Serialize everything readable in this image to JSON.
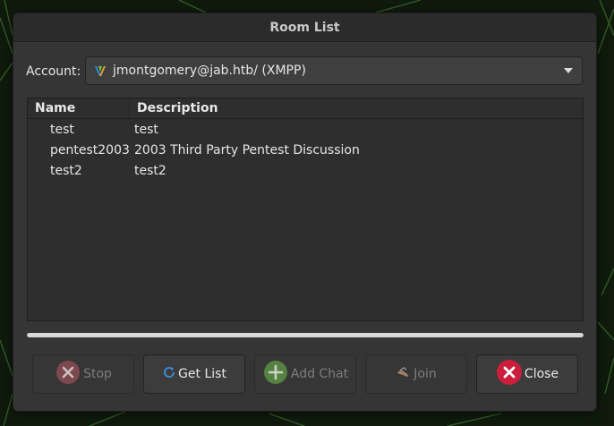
{
  "window": {
    "title": "Room List"
  },
  "account": {
    "label": "Account:",
    "value": "jmontgomery@jab.htb/ (XMPP)",
    "icon": "xmpp-protocol-icon"
  },
  "list": {
    "columns": [
      "Name",
      "Description"
    ],
    "rows": [
      {
        "name": "test",
        "description": "test"
      },
      {
        "name": "pentest2003",
        "description": "2003 Third Party Pentest Discussion"
      },
      {
        "name": "test2",
        "description": "test2"
      }
    ]
  },
  "progress": {
    "value": 1.0
  },
  "buttons": {
    "stop": "Stop",
    "get_list": "Get List",
    "add_chat": "Add Chat",
    "join": "Join",
    "close": "Close"
  },
  "colors": {
    "window_bg": "#353535",
    "titlebar_bg": "#2b2b2b",
    "close_red": "#cc1e3c",
    "refresh_blue": "#3d8fe0",
    "add_green": "#6fbf4a"
  }
}
